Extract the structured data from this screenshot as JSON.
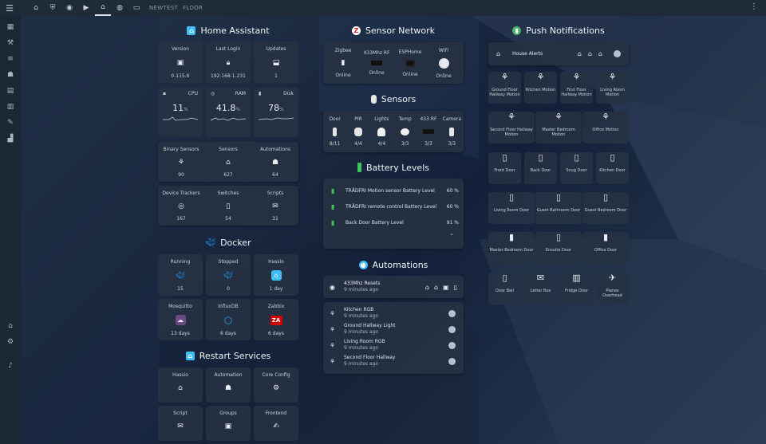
{
  "topbar": {
    "tabs": [
      {
        "icon": "home-icon",
        "glyph": "⌂"
      },
      {
        "icon": "shield-icon",
        "glyph": "⛨"
      },
      {
        "icon": "cctv-icon",
        "glyph": "◉"
      },
      {
        "icon": "terminal-icon",
        "glyph": "▶"
      },
      {
        "icon": "house-icon",
        "glyph": "⌂"
      },
      {
        "icon": "globe-icon",
        "glyph": "◍"
      },
      {
        "icon": "bed-icon",
        "glyph": "▭"
      }
    ],
    "text_tabs": [
      "NEWTEST",
      "FLOOR"
    ]
  },
  "sidebar": {
    "items": [
      "dashboard-icon",
      "hammer-icon",
      "list-icon",
      "robot-icon",
      "book-icon",
      "server-icon",
      "wrench-icon",
      "chart-icon"
    ],
    "bottom": [
      "house-icon",
      "gear-icon",
      "bell-icon"
    ]
  },
  "home_assistant": {
    "title": "Home Assistant",
    "version": {
      "label": "Version",
      "value": "0.115.6"
    },
    "last_login": {
      "label": "Last Login",
      "value": "192.168.1.231"
    },
    "updates": {
      "label": "Updates",
      "value": "1"
    },
    "cpu": {
      "label": "CPU",
      "value": "11",
      "unit": "%"
    },
    "ram": {
      "label": "RAM",
      "value": "41.8",
      "unit": "%"
    },
    "disk": {
      "label": "Disk",
      "value": "78",
      "unit": "%"
    },
    "binary_sensors": {
      "label": "Binary Sensors",
      "value": "90"
    },
    "sensors": {
      "label": "Sensors",
      "value": "627"
    },
    "automations": {
      "label": "Automations",
      "value": "64"
    },
    "device_trackers": {
      "label": "Device Trackers",
      "value": "167"
    },
    "switches": {
      "label": "Switches",
      "value": "54"
    },
    "scripts": {
      "label": "Scripts",
      "value": "31"
    }
  },
  "docker": {
    "title": "Docker",
    "running": {
      "label": "Running",
      "value": "15"
    },
    "stopped": {
      "label": "Stopped",
      "value": "0"
    },
    "hassio": {
      "label": "Hassio",
      "value": "1 day"
    },
    "mosquitto": {
      "label": "Mosquitto",
      "value": "13 days"
    },
    "influxdb": {
      "label": "InfluxDB",
      "value": "6 days"
    },
    "zabbix": {
      "label": "Zabbix",
      "value": "6 days",
      "logo": "ZA"
    }
  },
  "restart_services": {
    "title": "Restart Services",
    "items": [
      "Hassio",
      "Automation",
      "Core Config",
      "Script",
      "Groups",
      "Frontend"
    ]
  },
  "sensor_network": {
    "title": "Sensor Network",
    "items": [
      {
        "label": "Zigbee",
        "status": "Online"
      },
      {
        "label": "433Mhz RF",
        "status": "Online"
      },
      {
        "label": "ESPHome",
        "status": "Online"
      },
      {
        "label": "WiFi",
        "status": "Online"
      }
    ]
  },
  "sensors_section": {
    "title": "Sensors",
    "items": [
      {
        "label": "Door",
        "value": "8/11"
      },
      {
        "label": "PIR",
        "value": "4/4"
      },
      {
        "label": "Lights",
        "value": "4/4"
      },
      {
        "label": "Temp",
        "value": "3/3"
      },
      {
        "label": "433 RF",
        "value": "3/3"
      },
      {
        "label": "Camera",
        "value": "3/3"
      }
    ]
  },
  "battery": {
    "title": "Battery Levels",
    "rows": [
      {
        "label": "TRÅDFRI Motion sensor Battery Level",
        "value": "60 %"
      },
      {
        "label": "TRÅDFRI remote control Battery Level",
        "value": "60 %"
      },
      {
        "label": "Back Door Battery Level",
        "value": "91 %"
      }
    ]
  },
  "automations_section": {
    "title": "Automations",
    "reset": {
      "label": "433Mhz Resets",
      "time": "9 minutes ago"
    },
    "rows": [
      {
        "label": "Kitchen RGB",
        "time": "9 minutes ago"
      },
      {
        "label": "Ground Hallway Light",
        "time": "9 minutes ago"
      },
      {
        "label": "Living Room RGB",
        "time": "9 minutes ago"
      },
      {
        "label": "Second Floor Hallway",
        "time": "9 minutes ago"
      }
    ]
  },
  "push": {
    "title": "Push Notifications",
    "house_alerts": "House Alerts",
    "motion": [
      "Ground Floor Hallway Motion",
      "Kitchen Motion",
      "First Floor Hallway Motion",
      "Living Room Motion"
    ],
    "motion2": [
      "Second Floor Hallway Motion",
      "Master Bedroom Motion",
      "Office Motion"
    ],
    "doors1": [
      "Front Door",
      "Back Door",
      "Snug Door",
      "Kitchen Door"
    ],
    "doors2": [
      "Living Room Door",
      "Guest Bathroom Door",
      "Guest Bedroom Door"
    ],
    "doors3": [
      "Master Bedroom Door",
      "Ensuite Door",
      "Office Door"
    ],
    "misc": [
      "Door Bell",
      "Letter Box",
      "Fridge Door",
      "Planes Overhead"
    ]
  }
}
